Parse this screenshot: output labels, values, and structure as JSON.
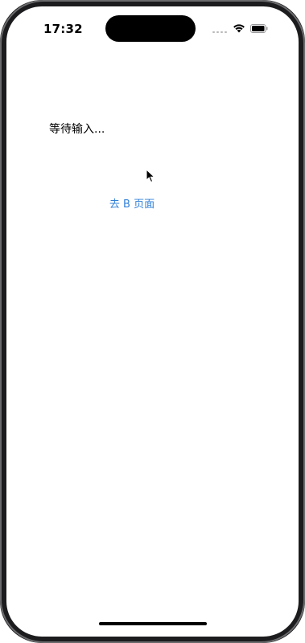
{
  "status_bar": {
    "time": "17:32",
    "signal_icon": "cellular-signal-icon",
    "wifi_icon": "wifi-icon",
    "battery_icon": "battery-icon"
  },
  "content": {
    "status_text": "等待输入...",
    "go_button_label": "去 B 页面"
  },
  "colors": {
    "link": "#2f7fd8",
    "text": "#000000",
    "background": "#ffffff"
  }
}
